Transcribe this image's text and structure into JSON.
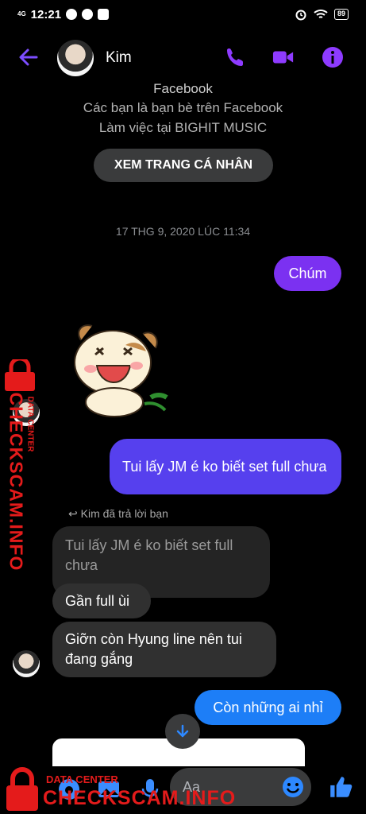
{
  "status": {
    "network": "4G",
    "time": "12:21",
    "battery": "89"
  },
  "header": {
    "contact_name": "Kim"
  },
  "profile": {
    "line_top": "Facebook",
    "friends_line": "Các bạn là bạn bè trên Facebook",
    "work_line": "Làm việc tại BIGHIT MUSIC",
    "view_profile_label": "XEM TRANG CÁ NHÂN"
  },
  "conversation": {
    "timestamp": "17 THG 9, 2020 LÚC 11:34",
    "messages": [
      {
        "from": "me",
        "text": "Chúm"
      },
      {
        "from": "me",
        "text": "Tui lấy JM é ko biết set full chưa"
      },
      {
        "from": "them",
        "text": "Gần full ùi"
      },
      {
        "from": "them",
        "text": "Giỡn còn Hyung line nên tui đang gắng"
      },
      {
        "from": "me",
        "text": "Còn những ai nhỉ"
      }
    ],
    "reply_label": "Kim đã trả lời bạn",
    "quoted_text": "Tui lấy JM é ko biết set full chưa"
  },
  "composer": {
    "placeholder": "Aa"
  },
  "watermark": {
    "small": "DATA CENTER",
    "big": "CHECKSCAM.INFO",
    "color": "#e41b1b"
  },
  "colors": {
    "accent": "#8e3bff",
    "bubble_purple": "#7b31f1",
    "bubble_indigo": "#5640ee",
    "bubble_blue": "#1d7ef7",
    "incoming": "#303030"
  }
}
